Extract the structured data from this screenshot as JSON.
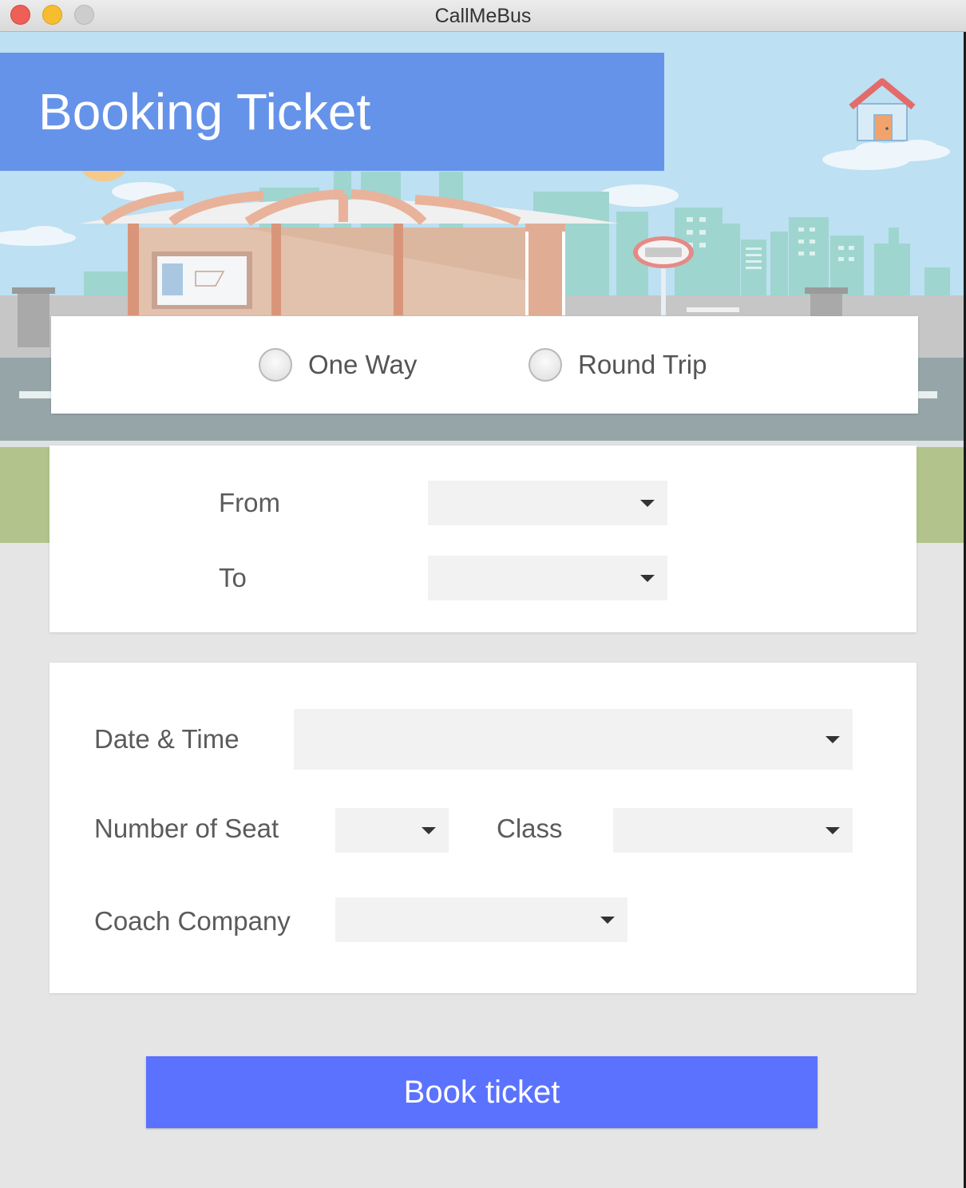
{
  "window": {
    "title": "CallMeBus"
  },
  "header": {
    "title": "Booking Ticket",
    "home_icon": "house-icon"
  },
  "trip_type": {
    "options": [
      {
        "label": "One Way",
        "selected": false
      },
      {
        "label": "Round Trip",
        "selected": false
      }
    ]
  },
  "route": {
    "from_label": "From",
    "from_value": "",
    "to_label": "To",
    "to_value": ""
  },
  "details": {
    "date_label": "Date & Time",
    "date_value": "",
    "seats_label": "Number of Seat",
    "seats_value": "",
    "class_label": "Class",
    "class_value": "",
    "company_label": "Coach Company",
    "company_value": ""
  },
  "actions": {
    "book_label": "Book ticket"
  },
  "colors": {
    "header_bg": "#6693ea",
    "book_button": "#5b72ff",
    "sky": "#bde0f2",
    "grass": "#b2c48c",
    "road": "#96a6a8"
  }
}
